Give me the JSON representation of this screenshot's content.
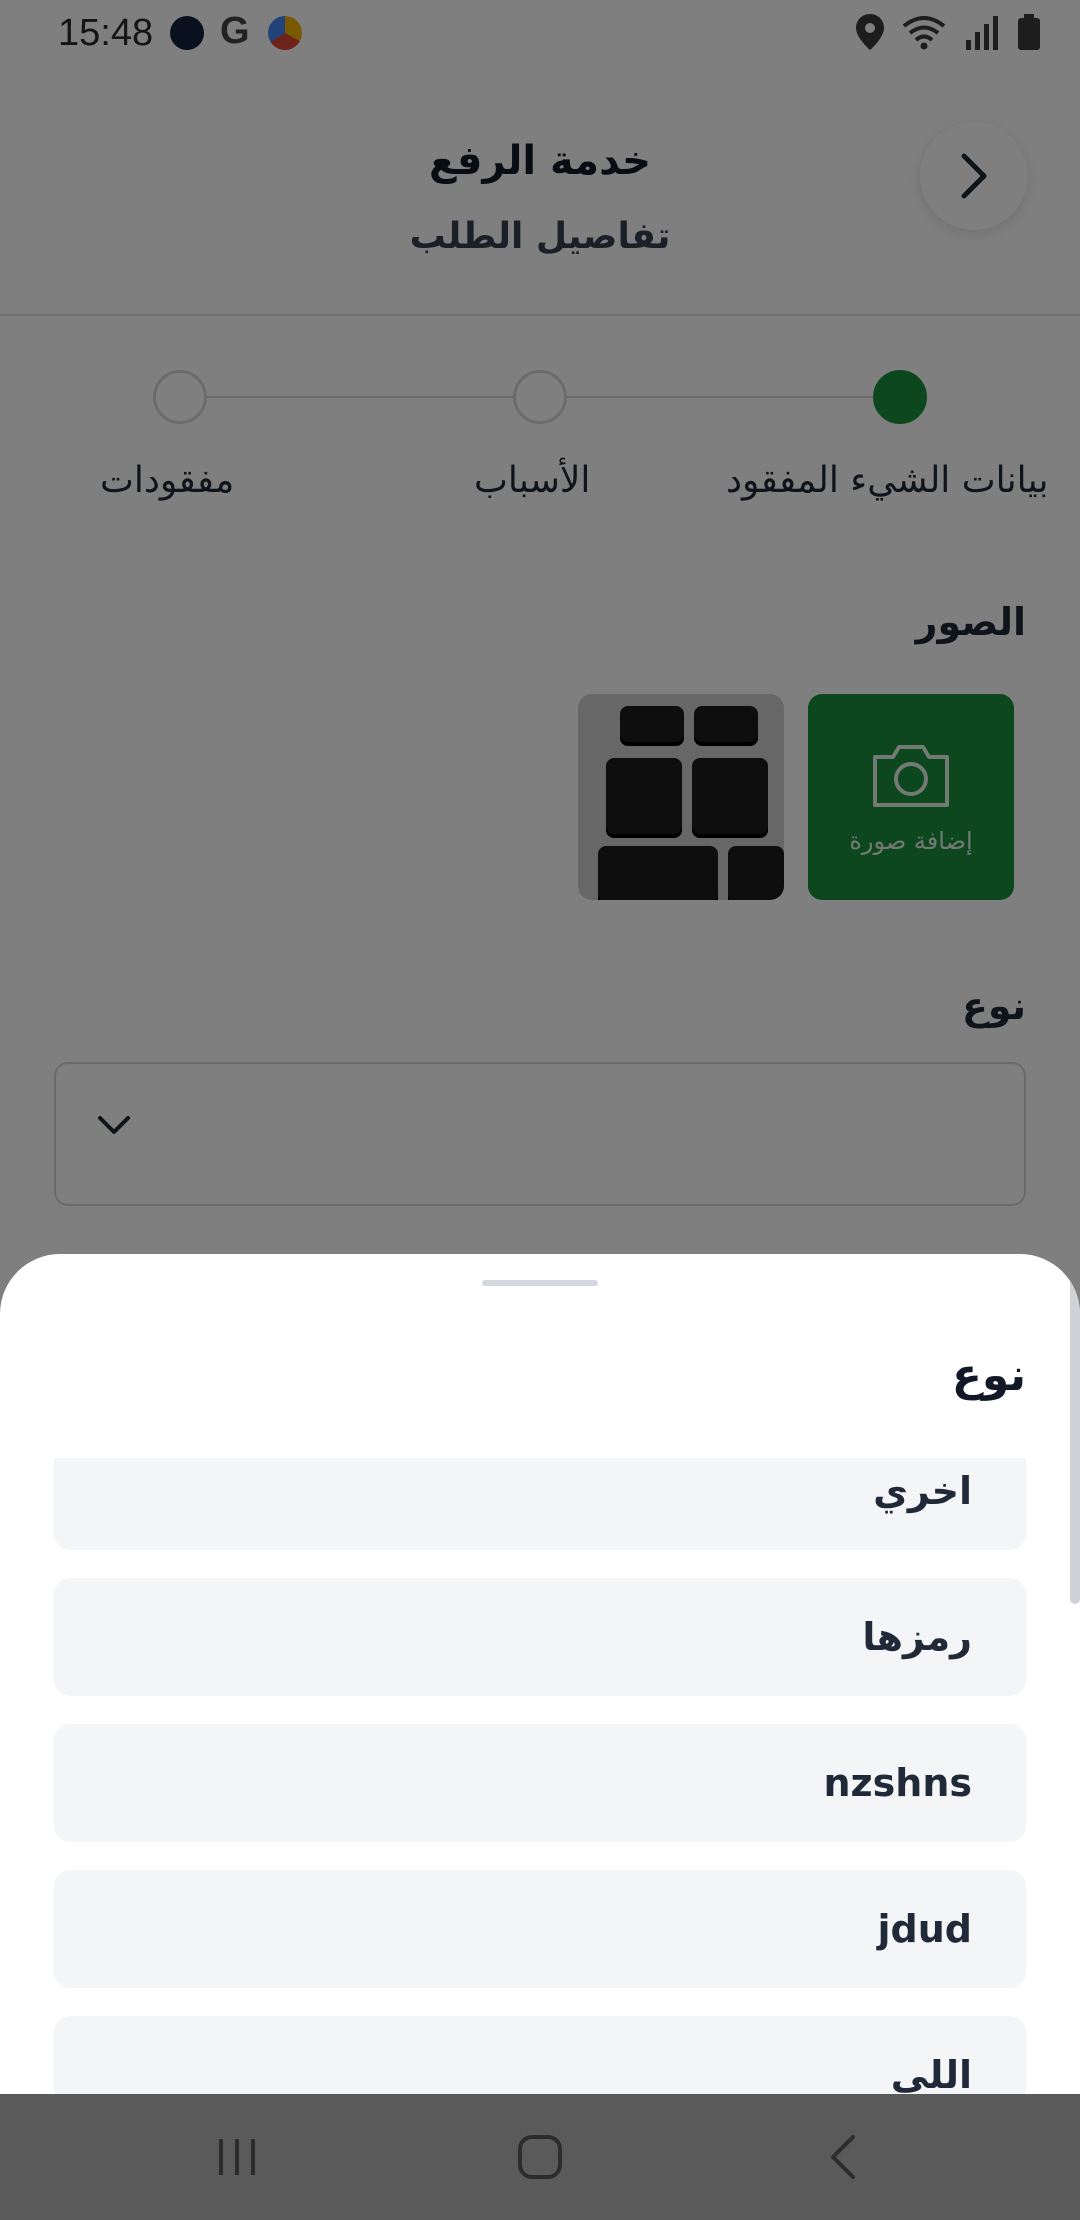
{
  "status_bar": {
    "time": "15:48",
    "icons": [
      "app-notification-icon",
      "google-icon",
      "browser-icon",
      "location-icon",
      "wifi-icon",
      "signal-icon",
      "battery-icon"
    ]
  },
  "header": {
    "title": "خدمة الرفع",
    "subtitle": "تفاصيل الطلب",
    "back_icon": "chevron-right-icon"
  },
  "stepper": {
    "steps": [
      {
        "label": "بيانات الشيء المفقود",
        "active": true
      },
      {
        "label": "الأسباب",
        "active": false
      },
      {
        "label": "مفقودات",
        "active": false
      }
    ]
  },
  "photos": {
    "label": "الصور",
    "add_label": "إضافة صورة"
  },
  "type_field": {
    "label": "نوع"
  },
  "sheet": {
    "title": "نوع",
    "options": [
      {
        "label": "اخري"
      },
      {
        "label": "رمزها"
      },
      {
        "label": "nzshns"
      },
      {
        "label": "jdud"
      },
      {
        "label": "اللي"
      }
    ]
  },
  "colors": {
    "accent": "#1a8f3c",
    "overlay": "rgba(0,0,0,0.5)",
    "option_bg": "#f4f5f7"
  }
}
